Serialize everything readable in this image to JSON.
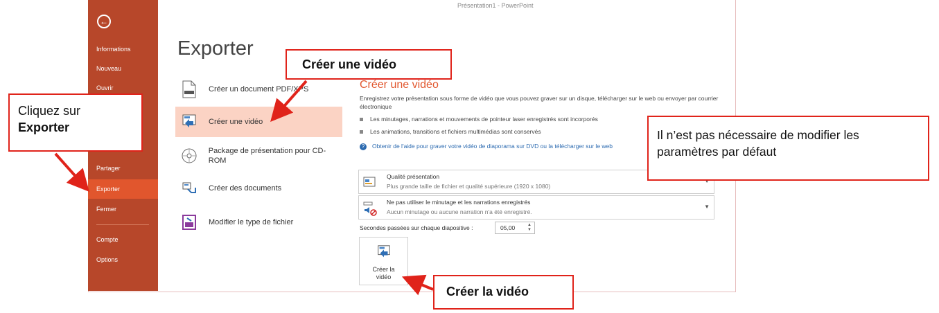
{
  "window": {
    "title": "Présentation1 - PowerPoint"
  },
  "sidebar": {
    "items": [
      {
        "label": "Informations"
      },
      {
        "label": "Nouveau"
      },
      {
        "label": "Ouvrir"
      },
      {
        "label": "Partager"
      },
      {
        "label": "Exporter"
      },
      {
        "label": "Fermer"
      },
      {
        "label": "Compte"
      },
      {
        "label": "Options"
      }
    ]
  },
  "main": {
    "title": "Exporter",
    "options": [
      {
        "label": "Créer un document PDF/XPS",
        "icon": "pdf-document-icon"
      },
      {
        "label": "Créer une vidéo",
        "icon": "video-icon"
      },
      {
        "label": "Package de présentation pour CD-ROM",
        "icon": "cd-icon"
      },
      {
        "label": "Créer des documents",
        "icon": "handouts-icon"
      },
      {
        "label": "Modifier le type de fichier",
        "icon": "file-type-icon"
      }
    ]
  },
  "panel": {
    "heading": "Créer une vidéo",
    "description": "Enregistrez votre présentation sous forme de vidéo que vous pouvez graver sur un disque, télécharger sur le web ou envoyer par courrier électronique",
    "bullets": [
      "Les minutages, narrations et mouvements de pointeur laser enregistrés sont incorporés",
      "Les animations, transitions et fichiers multimédias sont conservés"
    ],
    "help_link": "Obtenir de l'aide pour graver votre vidéo de diaporama sur DVD ou la télécharger sur le web",
    "quality": {
      "title": "Qualité présentation",
      "subtitle": "Plus grande taille de fichier et qualité supérieure (1920 x 1080)"
    },
    "timing": {
      "title": "Ne pas utiliser le minutage et les narrations enregistrés",
      "subtitle": "Aucun minutage ou aucune narration n'a été enregistré."
    },
    "seconds_label": "Secondes passées sur chaque diapositive :",
    "seconds_value": "05,00",
    "create_button": "Créer la vidéo"
  },
  "callouts": {
    "exporter_line1": "Cliquez sur",
    "exporter_line2": "Exporter",
    "creer_video": "Créer une vidéo",
    "params": "Il n’est pas nécessaire de modifier les paramètres par défaut",
    "creer_la_video": "Créer la vidéo"
  },
  "colors": {
    "accent": "#b7472a",
    "active": "#e1562d",
    "callout_border": "#e0231a",
    "selected_option": "#fbd3c4"
  }
}
